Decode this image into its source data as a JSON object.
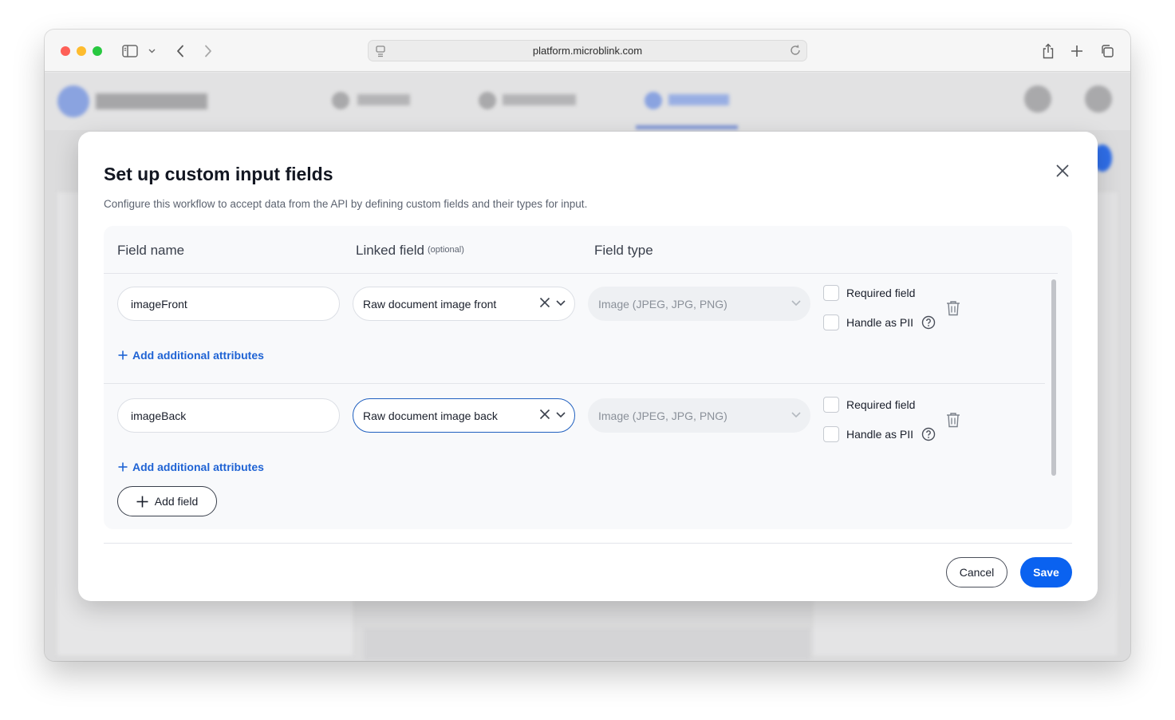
{
  "browser": {
    "url": "platform.microblink.com"
  },
  "modal": {
    "title": "Set up custom input fields",
    "subtitle": "Configure this workflow to accept data from the API by defining custom fields and their types for input.",
    "columns": {
      "field_name": "Field name",
      "linked_field": "Linked field",
      "linked_field_hint": "(optional)",
      "field_type": "Field type"
    },
    "rows": [
      {
        "field_name": "imageFront",
        "linked_field": "Raw document image front",
        "field_type": "Image (JPEG, JPG, PNG)",
        "required_label": "Required field",
        "pii_label": "Handle as PII",
        "add_attributes": "Add additional attributes"
      },
      {
        "field_name": "imageBack",
        "linked_field": "Raw document image back",
        "field_type": "Image (JPEG, JPG, PNG)",
        "required_label": "Required field",
        "pii_label": "Handle as PII",
        "add_attributes": "Add additional attributes"
      }
    ],
    "add_field_label": "Add field",
    "cancel_label": "Cancel",
    "save_label": "Save"
  },
  "colors": {
    "primary": "#0a62f0",
    "link": "#1f63d4",
    "focus_border": "#1f5fbf"
  }
}
